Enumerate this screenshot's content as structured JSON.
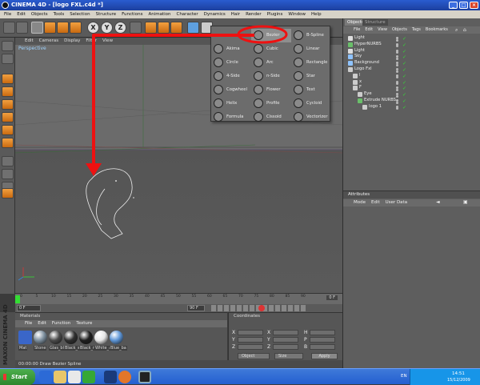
{
  "window": {
    "title": "CINEMA 4D - [logo FXL.c4d *]",
    "min": "_",
    "max": "□",
    "close": "×"
  },
  "menubar": [
    "File",
    "Edit",
    "Objects",
    "Tools",
    "Selection",
    "Structure",
    "Functions",
    "Animation",
    "Character",
    "Dynamics",
    "Hair",
    "Render",
    "Plugins",
    "Window",
    "Help"
  ],
  "toolbar": {
    "x_label": "X",
    "y_label": "Y",
    "z_label": "Z"
  },
  "viewport": {
    "menu": [
      "Edit",
      "Cameras",
      "Display",
      "Filter",
      "View"
    ],
    "label": "Perspective"
  },
  "spline_menu": {
    "items": [
      {
        "label": "Bezier",
        "icon": "bezier-spline-icon",
        "highlight": true
      },
      {
        "label": "B-Spline",
        "icon": "b-spline-icon"
      },
      {
        "label": "Akima",
        "icon": "akima-icon"
      },
      {
        "label": "Cubic",
        "icon": "cubic-icon"
      },
      {
        "label": "Linear",
        "icon": "linear-icon"
      },
      {
        "label": "Circle",
        "icon": "circle-icon"
      },
      {
        "label": "Arc",
        "icon": "arc-icon"
      },
      {
        "label": "Rectangle",
        "icon": "rectangle-icon"
      },
      {
        "label": "4-Side",
        "icon": "four-side-icon"
      },
      {
        "label": "n-Side",
        "icon": "n-side-icon"
      },
      {
        "label": "Star",
        "icon": "star-icon"
      },
      {
        "label": "Cogwheel",
        "icon": "cogwheel-icon"
      },
      {
        "label": "Flower",
        "icon": "flower-icon"
      },
      {
        "label": "Text",
        "icon": "text-icon"
      },
      {
        "label": "Helix",
        "icon": "helix-icon"
      },
      {
        "label": "Profile",
        "icon": "profile-icon"
      },
      {
        "label": "Cycloid",
        "icon": "cycloid-icon"
      },
      {
        "label": "Formula",
        "icon": "formula-icon"
      },
      {
        "label": "Cissoid",
        "icon": "cissoid-icon"
      },
      {
        "label": "Vectorizer",
        "icon": "vectorizer-icon"
      }
    ]
  },
  "timeline": {
    "ticks": [
      "0",
      "5",
      "10",
      "15",
      "20",
      "25",
      "30",
      "35",
      "40",
      "45",
      "50",
      "55",
      "60",
      "65",
      "70",
      "75",
      "80",
      "85",
      "90"
    ],
    "end_label": "0 F",
    "start_field": "0 F",
    "end_field": "90 F"
  },
  "materials": {
    "title": "Materials",
    "menu": [
      "File",
      "Edit",
      "Function",
      "Texture"
    ],
    "items": [
      {
        "label": "Mat",
        "color": "#3a66c8"
      },
      {
        "label": "Stone",
        "color": "#7d8f9e"
      },
      {
        "label": "Glas_bl",
        "color": "#4a4a4a"
      },
      {
        "label": "Black_s",
        "color": "#303030"
      },
      {
        "label": "Black_m",
        "color": "#1f1f1f"
      },
      {
        "label": "White_a",
        "color": "#e6e6e6"
      },
      {
        "label": "Blue_ba",
        "color": "#5d95d6"
      }
    ]
  },
  "coordinates": {
    "title": "Coordinates",
    "axes": [
      "X",
      "Y",
      "Z"
    ],
    "col2_axes": [
      "X",
      "Y",
      "Z"
    ],
    "col3_axes": [
      "H",
      "P",
      "B"
    ],
    "object_select": "Object",
    "size_select": "Size",
    "apply": "Apply"
  },
  "status": "00:00:00   Draw Bezier Spline",
  "brand": "MAXON CINEMA 4D",
  "objects_panel": {
    "tabs": [
      "Objects",
      "Structure"
    ],
    "menu": [
      "File",
      "Edit",
      "View",
      "Objects",
      "Tags",
      "Bookmarks"
    ],
    "rows": [
      {
        "label": "Light",
        "indent": 0,
        "icon_color": "#ddd"
      },
      {
        "label": "HyperNURBS",
        "indent": 0,
        "icon_color": "#6abf6a"
      },
      {
        "label": "Light",
        "indent": 0,
        "icon_color": "#ddd"
      },
      {
        "label": "Sky",
        "indent": 0,
        "icon_color": "#8fc3ff"
      },
      {
        "label": "Background",
        "indent": 0,
        "icon_color": "#8fc3ff"
      },
      {
        "label": "Logo Fxl",
        "indent": 0,
        "icon_color": "#ccc"
      },
      {
        "label": "l",
        "indent": 1,
        "icon_color": "#ccc"
      },
      {
        "label": "x",
        "indent": 1,
        "icon_color": "#ccc"
      },
      {
        "label": "F",
        "indent": 1,
        "icon_color": "#ccc"
      },
      {
        "label": "Eye",
        "indent": 2,
        "icon_color": "#ccc"
      },
      {
        "label": "Extrude NURBS",
        "indent": 2,
        "icon_color": "#6abf6a"
      },
      {
        "label": "logo 1",
        "indent": 3,
        "icon_color": "#ccc"
      }
    ]
  },
  "attributes_panel": {
    "title": "Attributes",
    "menu": [
      "Mode",
      "Edit",
      "User Data"
    ]
  },
  "taskbar": {
    "start": "Start",
    "lang": "EN",
    "time": "14:51",
    "date": "15/12/2009"
  },
  "annotation": {
    "color": "#ee1111"
  }
}
